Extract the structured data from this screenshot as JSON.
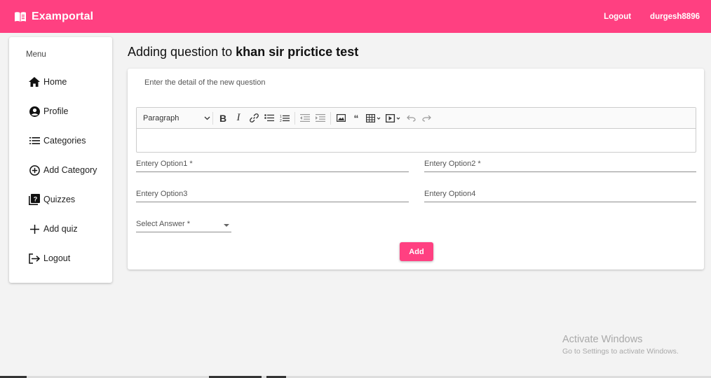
{
  "header": {
    "brand_title": "Examportal",
    "brand_icon": "book-icon",
    "logout_label": "Logout",
    "username": "durgesh8896",
    "accent_color": "#ff4081"
  },
  "sidebar": {
    "menu_title": "Menu",
    "items": [
      {
        "label": "Home",
        "icon": "home-icon"
      },
      {
        "label": "Profile",
        "icon": "account-circle-icon"
      },
      {
        "label": "Categories",
        "icon": "list-icon"
      },
      {
        "label": "Add Category",
        "icon": "add-circle-icon"
      },
      {
        "label": "Quizzes",
        "icon": "quiz-icon"
      },
      {
        "label": "Add quiz",
        "icon": "plus-icon"
      },
      {
        "label": "Logout",
        "icon": "logout-icon"
      }
    ]
  },
  "main": {
    "heading_prefix": "Adding question to ",
    "quiz_title": "khan sir prictice test",
    "card_subtitle": "Enter the detail of the new question",
    "editor": {
      "paragraph_style": "Paragraph",
      "tools": [
        "bold-icon",
        "italic-icon",
        "link-icon",
        "bulleted-list-icon",
        "numbered-list-icon",
        "outdent-icon",
        "indent-icon",
        "image-icon",
        "blockquote-icon",
        "table-icon",
        "media-icon",
        "undo-icon",
        "redo-icon"
      ]
    },
    "option1_label": "Entery Option1 *",
    "option2_label": "Entery Option2 *",
    "option3_label": "Entery Option3",
    "option4_label": "Entery Option4",
    "answer_label": "Select Answer *",
    "add_button": "Add"
  },
  "watermark": {
    "line1": "Activate Windows",
    "line2": "Go to Settings to activate Windows."
  }
}
